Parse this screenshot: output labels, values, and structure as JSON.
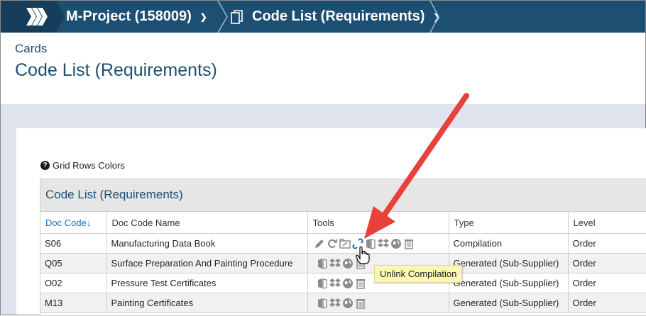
{
  "breadcrumb": {
    "project": "M-Project (158009)",
    "page": "Code List (Requirements)"
  },
  "header": {
    "section": "Cards",
    "title": "Code List (Requirements)"
  },
  "grid_colors_label": "Grid Rows Colors",
  "grid": {
    "title": "Code List (Requirements)",
    "columns": {
      "doc_code": "Doc Code↓",
      "doc_code_name": "Doc Code Name",
      "tools": "Tools",
      "type": "Type",
      "level": "Level"
    },
    "rows": [
      {
        "code": "S06",
        "name": "Manufacturing Data Book",
        "type": "Compilation",
        "level": "Order"
      },
      {
        "code": "Q05",
        "name": "Surface Preparation And Painting Procedure",
        "type": "Generated (Sub-Supplier)",
        "level": "Order"
      },
      {
        "code": "O02",
        "name": "Pressure Test Certificates",
        "type": "Generated (Sub-Supplier)",
        "level": "Order"
      },
      {
        "code": "M13",
        "name": "Painting Certificates",
        "type": "Generated (Sub-Supplier)",
        "level": "Order"
      }
    ]
  },
  "tooltip": "Unlink Compilation",
  "colors": {
    "topbar": "#1d4f73",
    "accent": "#1b6ec2",
    "annotation_arrow": "#e8413b",
    "tooltip_bg": "#fbf7b4"
  }
}
